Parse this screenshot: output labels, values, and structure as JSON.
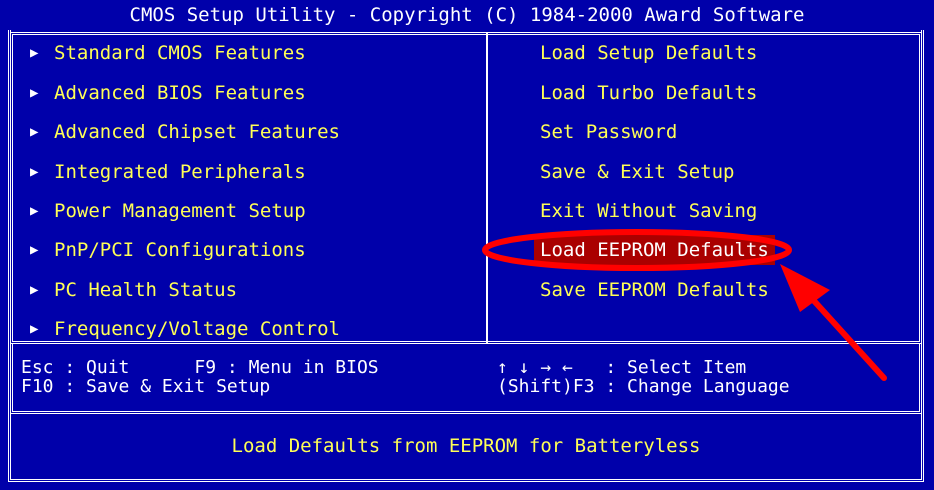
{
  "title": "CMOS Setup Utility - Copyright (C) 1984-2000 Award Software",
  "left_menu": [
    "Standard CMOS Features",
    "Advanced BIOS Features",
    "Advanced Chipset Features",
    "Integrated Peripherals",
    "Power Management Setup",
    "PnP/PCI Configurations",
    "PC Health Status",
    "Frequency/Voltage Control"
  ],
  "right_menu": [
    "Load Setup Defaults",
    "Load Turbo Defaults",
    "Set Password",
    "Save & Exit Setup",
    "Exit Without Saving",
    "Load EEPROM Defaults",
    "Save EEPROM Defaults"
  ],
  "selected_item": "Load EEPROM Defaults",
  "help": {
    "left_line1": "Esc : Quit      F9 : Menu in BIOS",
    "left_line2": "F10 : Save & Exit Setup",
    "right_line1": "↑ ↓ → ←   : Select Item",
    "right_line2": "(Shift)F3 : Change Language"
  },
  "status": "Load Defaults from EEPROM for Batteryless",
  "colors": {
    "background": "#0000aa",
    "text": "#ffff55",
    "highlight": "#aa0000",
    "annotation": "#ff0000"
  }
}
